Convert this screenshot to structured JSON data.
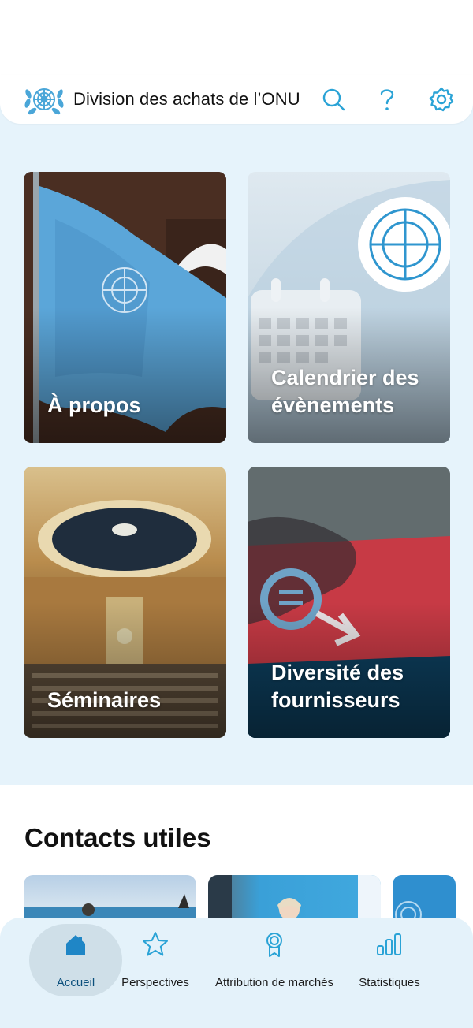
{
  "header": {
    "title": "Division des achats de l’ONU",
    "logo": "un-emblem",
    "icons": [
      "search-icon",
      "help-icon",
      "settings-icon"
    ],
    "accent": "#2aa3d6"
  },
  "tiles": [
    {
      "label": "À propos"
    },
    {
      "label": "Calendrier des évènements"
    },
    {
      "label": "Séminaires"
    },
    {
      "label": "Diversité des fournisseurs"
    }
  ],
  "contacts": {
    "title": "Contacts utiles"
  },
  "nav": {
    "items": [
      {
        "label": "Accueil",
        "icon": "home-icon",
        "active": true
      },
      {
        "label": "Perspectives",
        "icon": "star-icon"
      },
      {
        "label": "Attribution de marchés",
        "icon": "award-icon"
      },
      {
        "label": "Statistiques",
        "icon": "bar-chart-icon"
      }
    ],
    "active_color": "#0b4f7c"
  }
}
